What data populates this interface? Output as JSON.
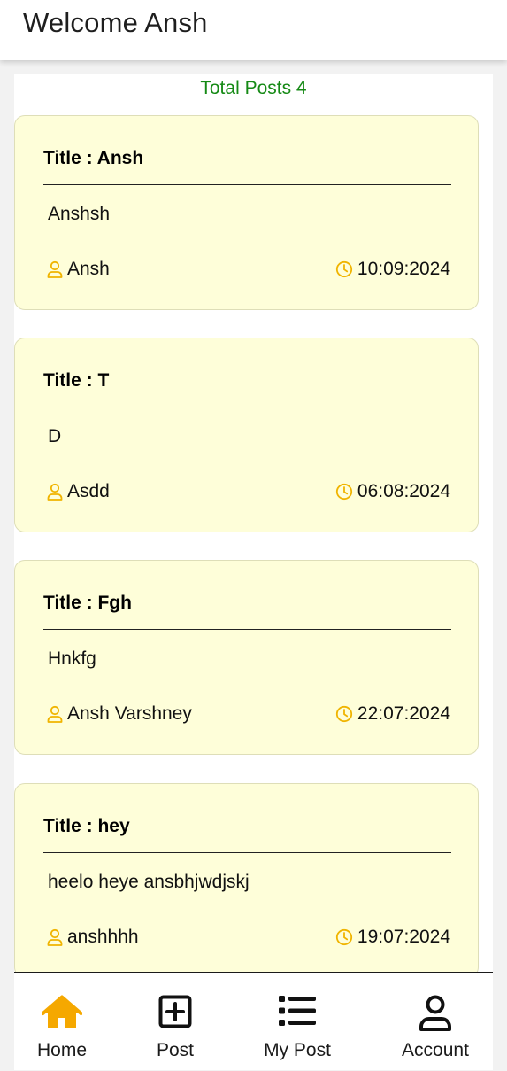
{
  "header": {
    "title": "Welcome Ansh"
  },
  "summary": {
    "total_posts": "Total Posts 4"
  },
  "posts": [
    {
      "title": "Title : Ansh",
      "body": "Anshsh",
      "author": "Ansh",
      "date": "10:09:2024"
    },
    {
      "title": "Title : T",
      "body": "D",
      "author": "Asdd",
      "date": "06:08:2024"
    },
    {
      "title": "Title : Fgh",
      "body": "Hnkfg",
      "author": "Ansh Varshney",
      "date": "22:07:2024"
    },
    {
      "title": "Title : hey",
      "body": "heelo heye ansbhjwdjskj",
      "author": "anshhhh",
      "date": "19:07:2024"
    }
  ],
  "bottom_nav": [
    {
      "label": "Home",
      "icon": "home-icon",
      "active": true
    },
    {
      "label": "Post",
      "icon": "add-square-icon",
      "active": false
    },
    {
      "label": "My Post",
      "icon": "list-icon",
      "active": false
    },
    {
      "label": "Account",
      "icon": "user-icon",
      "active": false
    }
  ],
  "colors": {
    "accent": "#f5a800",
    "total_posts_text": "#168a16",
    "card_background": "#fefed9",
    "icon_yellow": "#f0b400"
  }
}
